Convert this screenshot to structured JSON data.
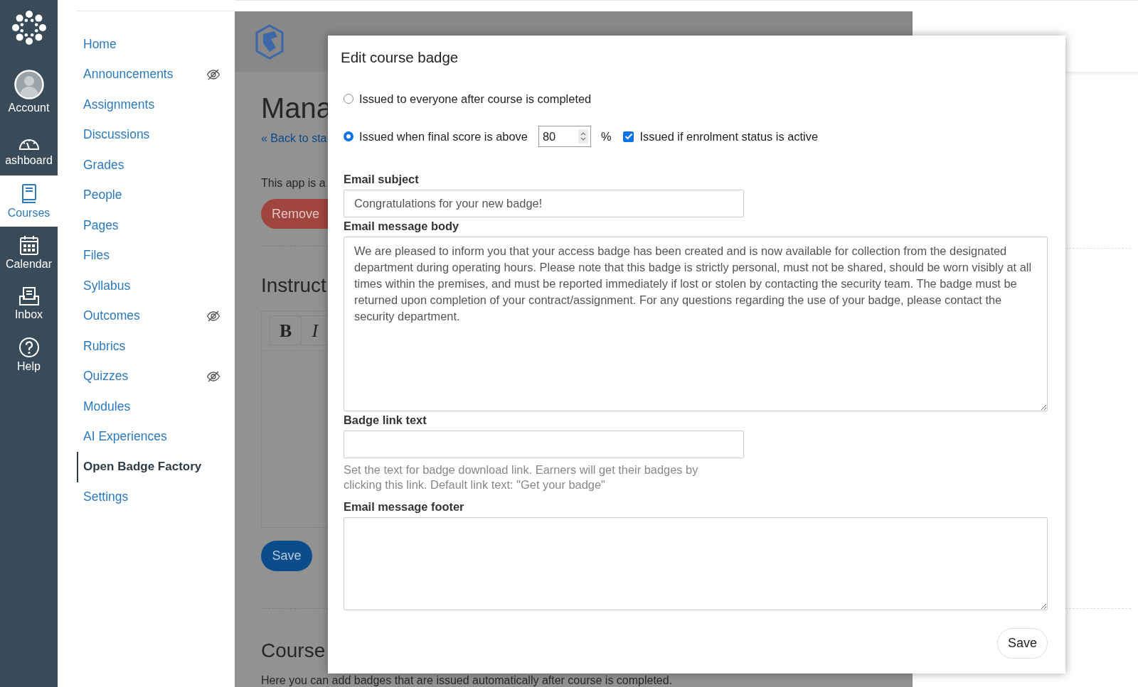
{
  "global_nav": {
    "items": [
      {
        "label": "Account",
        "selected": false
      },
      {
        "label": "ashboard",
        "selected": false
      },
      {
        "label": "Courses",
        "selected": true
      },
      {
        "label": "Calendar",
        "selected": false
      },
      {
        "label": "Inbox",
        "selected": false
      },
      {
        "label": "Help",
        "selected": false
      }
    ]
  },
  "course_nav": {
    "items": [
      {
        "label": "Home",
        "selected": false,
        "hidden": false
      },
      {
        "label": "Announcements",
        "selected": false,
        "hidden": true
      },
      {
        "label": "Assignments",
        "selected": false,
        "hidden": false
      },
      {
        "label": "Discussions",
        "selected": false,
        "hidden": false
      },
      {
        "label": "Grades",
        "selected": false,
        "hidden": false
      },
      {
        "label": "People",
        "selected": false,
        "hidden": false
      },
      {
        "label": "Pages",
        "selected": false,
        "hidden": false
      },
      {
        "label": "Files",
        "selected": false,
        "hidden": false
      },
      {
        "label": "Syllabus",
        "selected": false,
        "hidden": false
      },
      {
        "label": "Outcomes",
        "selected": false,
        "hidden": true
      },
      {
        "label": "Rubrics",
        "selected": false,
        "hidden": false
      },
      {
        "label": "Quizzes",
        "selected": false,
        "hidden": true
      },
      {
        "label": "Modules",
        "selected": false,
        "hidden": false
      },
      {
        "label": "AI Experiences",
        "selected": false,
        "hidden": false
      },
      {
        "label": "Open Badge Factory",
        "selected": true,
        "hidden": false
      },
      {
        "label": "Settings",
        "selected": false,
        "hidden": false
      }
    ]
  },
  "background_page": {
    "heading": "Mana",
    "back_link": "« Back to sta",
    "intro": "This app is a",
    "remove_button": "Remove",
    "section_heading": "Instruct",
    "editor_buttons": [
      "B",
      "I"
    ],
    "save_button": "Save",
    "courses_heading": "Course",
    "courses_text": "Here you can add badges that are issued automatically after course is completed."
  },
  "dialog": {
    "title": "Edit course badge",
    "options": [
      {
        "label": "Issued to everyone after course is completed",
        "selected": false
      },
      {
        "label": "Issued when final score is above",
        "selected": true
      }
    ],
    "score": "80",
    "percent": "%",
    "active_only": {
      "label": "Issued if enrolment status is active",
      "checked": true
    },
    "email_subject": {
      "label": "Email subject",
      "value": "Congratulations for your new badge!"
    },
    "email_body": {
      "label": "Email message body",
      "value": "We are pleased to inform you that your access badge has been created and is now available for collection from the designated department during operating hours. Please note that this badge is strictly personal, must not be shared, should be worn visibly at all times within the premises, and must be reported immediately if lost or stolen by contacting the security team. The badge must be returned upon completion of your contract/assignment. For any questions regarding the use of your badge, please contact the security department."
    },
    "badge_link": {
      "label": "Badge link text",
      "help": "Set the text for badge download link. Earners will get their badges by clicking this link. Default link text: \"Get your badge\""
    },
    "email_footer": {
      "label": "Email message footer"
    },
    "save_button": "Save"
  }
}
